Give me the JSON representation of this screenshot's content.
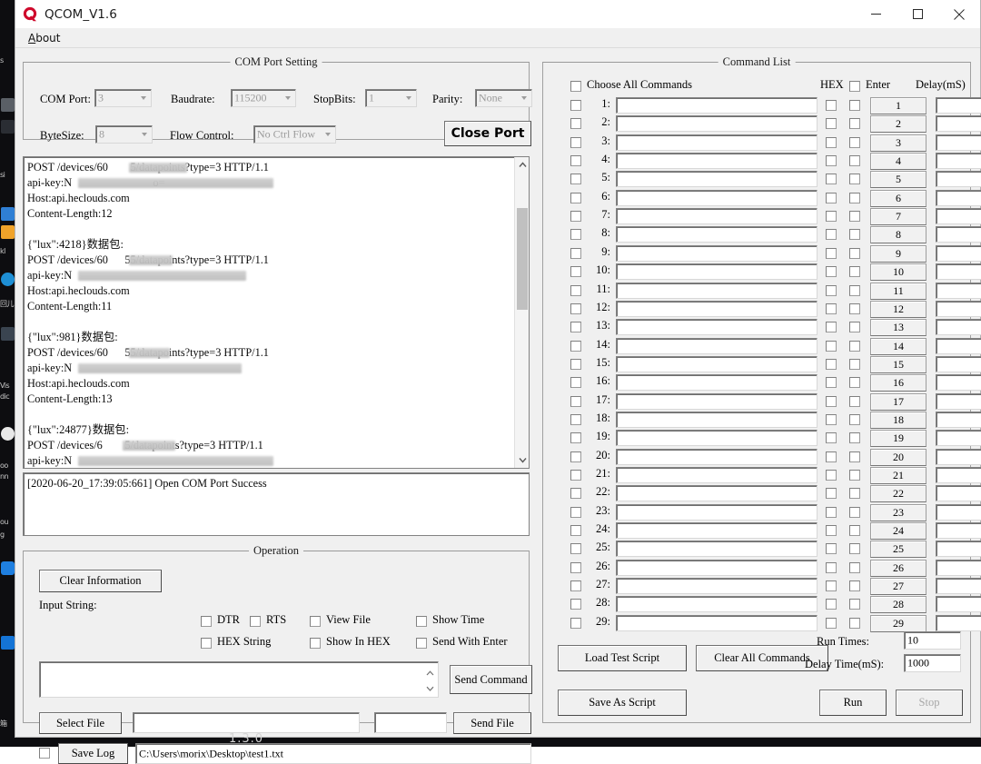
{
  "window": {
    "title": "QCOM_V1.6",
    "logo_icon": "qcom-logo-icon",
    "minimize_icon": "minimize-icon",
    "maximize_icon": "maximize-icon",
    "close_icon": "close-icon",
    "version_watermark": "1.3.0"
  },
  "menubar": {
    "items": [
      {
        "label": "About",
        "accel": "A"
      }
    ]
  },
  "com_port_setting": {
    "caption": "COM Port Setting",
    "fields": [
      {
        "label": "COM Port:",
        "value": "3",
        "disabled": true
      },
      {
        "label": "Baudrate:",
        "value": "115200",
        "disabled": true
      },
      {
        "label": "StopBits:",
        "value": "1",
        "disabled": true
      },
      {
        "label": "Parity:",
        "value": "None",
        "disabled": true
      },
      {
        "label": "ByteSize:",
        "value": "8",
        "disabled": true
      },
      {
        "label": "Flow Control:",
        "value": "No Ctrl Flow",
        "disabled": true
      }
    ],
    "close_port_button": "Close Port"
  },
  "receive_area": {
    "lines": [
      "POST /devices/60        5/datapoints?type=3 HTTP/1.1",
      "api-key:N                             o=",
      "Host:api.heclouds.com",
      "Content-Length:12",
      "",
      "{\"lux\":4218}数据包:",
      "POST /devices/60      55/datapoints?type=3 HTTP/1.1",
      "api-key:N                          ",
      "Host:api.heclouds.com",
      "Content-Length:11",
      "",
      "{\"lux\":981}数据包:",
      "POST /devices/60      55/datapoints?type=3 HTTP/1.1",
      "api-key:N                         ",
      "Host:api.heclouds.com",
      "Content-Length:13",
      "",
      "{\"lux\":24877}数据包:",
      "POST /devices/6        5/datapoints?type=3 HTTP/1.1",
      "api-key:N                       "
    ],
    "scrollbar": {
      "up_icon": "scroll-up-icon",
      "down_icon": "scroll-down-icon"
    }
  },
  "status_area": {
    "lines": [
      "[2020-06-20_17:39:05:661] Open COM Port Success"
    ]
  },
  "operation": {
    "caption": "Operation",
    "clear_information_button": "Clear Information",
    "checkboxes": [
      {
        "label": "DTR",
        "checked": false
      },
      {
        "label": "RTS",
        "checked": false
      },
      {
        "label": "View File",
        "checked": false
      },
      {
        "label": "Show Time",
        "checked": false
      },
      {
        "label": "HEX String",
        "checked": false
      },
      {
        "label": "Show In HEX",
        "checked": false
      },
      {
        "label": "Send With Enter",
        "checked": false
      }
    ],
    "input_string_label": "Input String:",
    "input_string_value": "",
    "send_command_button": "Send Command",
    "select_file_button": "Select File",
    "file_path_value": "",
    "file_size_value": "",
    "send_file_button": "Send File",
    "save_log_checked": false,
    "save_log_button": "Save Log",
    "save_log_path": "C:\\Users\\morix\\Desktop\\test1.txt"
  },
  "command_list": {
    "caption": "Command List",
    "choose_all_label": "Choose All Commands",
    "choose_all_checked": false,
    "hex_header": "HEX",
    "enter_header": "Enter",
    "enter_header_checked": false,
    "delay_header": "Delay(mS)",
    "rows": [
      {
        "index": "1:",
        "send_label": "1",
        "value": "",
        "hex": false,
        "enter": false,
        "delay": ""
      },
      {
        "index": "2:",
        "send_label": "2",
        "value": "",
        "hex": false,
        "enter": false,
        "delay": ""
      },
      {
        "index": "3:",
        "send_label": "3",
        "value": "",
        "hex": false,
        "enter": false,
        "delay": ""
      },
      {
        "index": "4:",
        "send_label": "4",
        "value": "",
        "hex": false,
        "enter": false,
        "delay": ""
      },
      {
        "index": "5:",
        "send_label": "5",
        "value": "",
        "hex": false,
        "enter": false,
        "delay": ""
      },
      {
        "index": "6:",
        "send_label": "6",
        "value": "",
        "hex": false,
        "enter": false,
        "delay": ""
      },
      {
        "index": "7:",
        "send_label": "7",
        "value": "",
        "hex": false,
        "enter": false,
        "delay": ""
      },
      {
        "index": "8:",
        "send_label": "8",
        "value": "",
        "hex": false,
        "enter": false,
        "delay": ""
      },
      {
        "index": "9:",
        "send_label": "9",
        "value": "",
        "hex": false,
        "enter": false,
        "delay": ""
      },
      {
        "index": "10:",
        "send_label": "10",
        "value": "",
        "hex": false,
        "enter": false,
        "delay": ""
      },
      {
        "index": "11:",
        "send_label": "11",
        "value": "",
        "hex": false,
        "enter": false,
        "delay": ""
      },
      {
        "index": "12:",
        "send_label": "12",
        "value": "",
        "hex": false,
        "enter": false,
        "delay": ""
      },
      {
        "index": "13:",
        "send_label": "13",
        "value": "",
        "hex": false,
        "enter": false,
        "delay": ""
      },
      {
        "index": "14:",
        "send_label": "14",
        "value": "",
        "hex": false,
        "enter": false,
        "delay": ""
      },
      {
        "index": "15:",
        "send_label": "15",
        "value": "",
        "hex": false,
        "enter": false,
        "delay": ""
      },
      {
        "index": "16:",
        "send_label": "16",
        "value": "",
        "hex": false,
        "enter": false,
        "delay": ""
      },
      {
        "index": "17:",
        "send_label": "17",
        "value": "",
        "hex": false,
        "enter": false,
        "delay": ""
      },
      {
        "index": "18:",
        "send_label": "18",
        "value": "",
        "hex": false,
        "enter": false,
        "delay": ""
      },
      {
        "index": "19:",
        "send_label": "19",
        "value": "",
        "hex": false,
        "enter": false,
        "delay": ""
      },
      {
        "index": "20:",
        "send_label": "20",
        "value": "",
        "hex": false,
        "enter": false,
        "delay": ""
      },
      {
        "index": "21:",
        "send_label": "21",
        "value": "",
        "hex": false,
        "enter": false,
        "delay": ""
      },
      {
        "index": "22:",
        "send_label": "22",
        "value": "",
        "hex": false,
        "enter": false,
        "delay": ""
      },
      {
        "index": "23:",
        "send_label": "23",
        "value": "",
        "hex": false,
        "enter": false,
        "delay": ""
      },
      {
        "index": "24:",
        "send_label": "24",
        "value": "",
        "hex": false,
        "enter": false,
        "delay": ""
      },
      {
        "index": "25:",
        "send_label": "25",
        "value": "",
        "hex": false,
        "enter": false,
        "delay": ""
      },
      {
        "index": "26:",
        "send_label": "26",
        "value": "",
        "hex": false,
        "enter": false,
        "delay": ""
      },
      {
        "index": "27:",
        "send_label": "27",
        "value": "",
        "hex": false,
        "enter": false,
        "delay": ""
      },
      {
        "index": "28:",
        "send_label": "28",
        "value": "",
        "hex": false,
        "enter": false,
        "delay": ""
      },
      {
        "index": "29:",
        "send_label": "29",
        "value": "",
        "hex": false,
        "enter": false,
        "delay": ""
      }
    ],
    "load_test_script_button": "Load Test Script",
    "clear_all_commands_button": "Clear All Commands",
    "save_as_script_button": "Save As Script",
    "run_times_label": "Run Times:",
    "run_times_value": "10",
    "delay_time_label": "Delay Time(mS):",
    "delay_time_value": "1000",
    "run_button": "Run",
    "stop_button": "Stop",
    "stop_disabled": true
  },
  "colors": {
    "window_face": "#f0f0f0",
    "titlebar": "#ffffff",
    "logo_red": "#cf0a2c",
    "desktop": "#0d0d10"
  }
}
